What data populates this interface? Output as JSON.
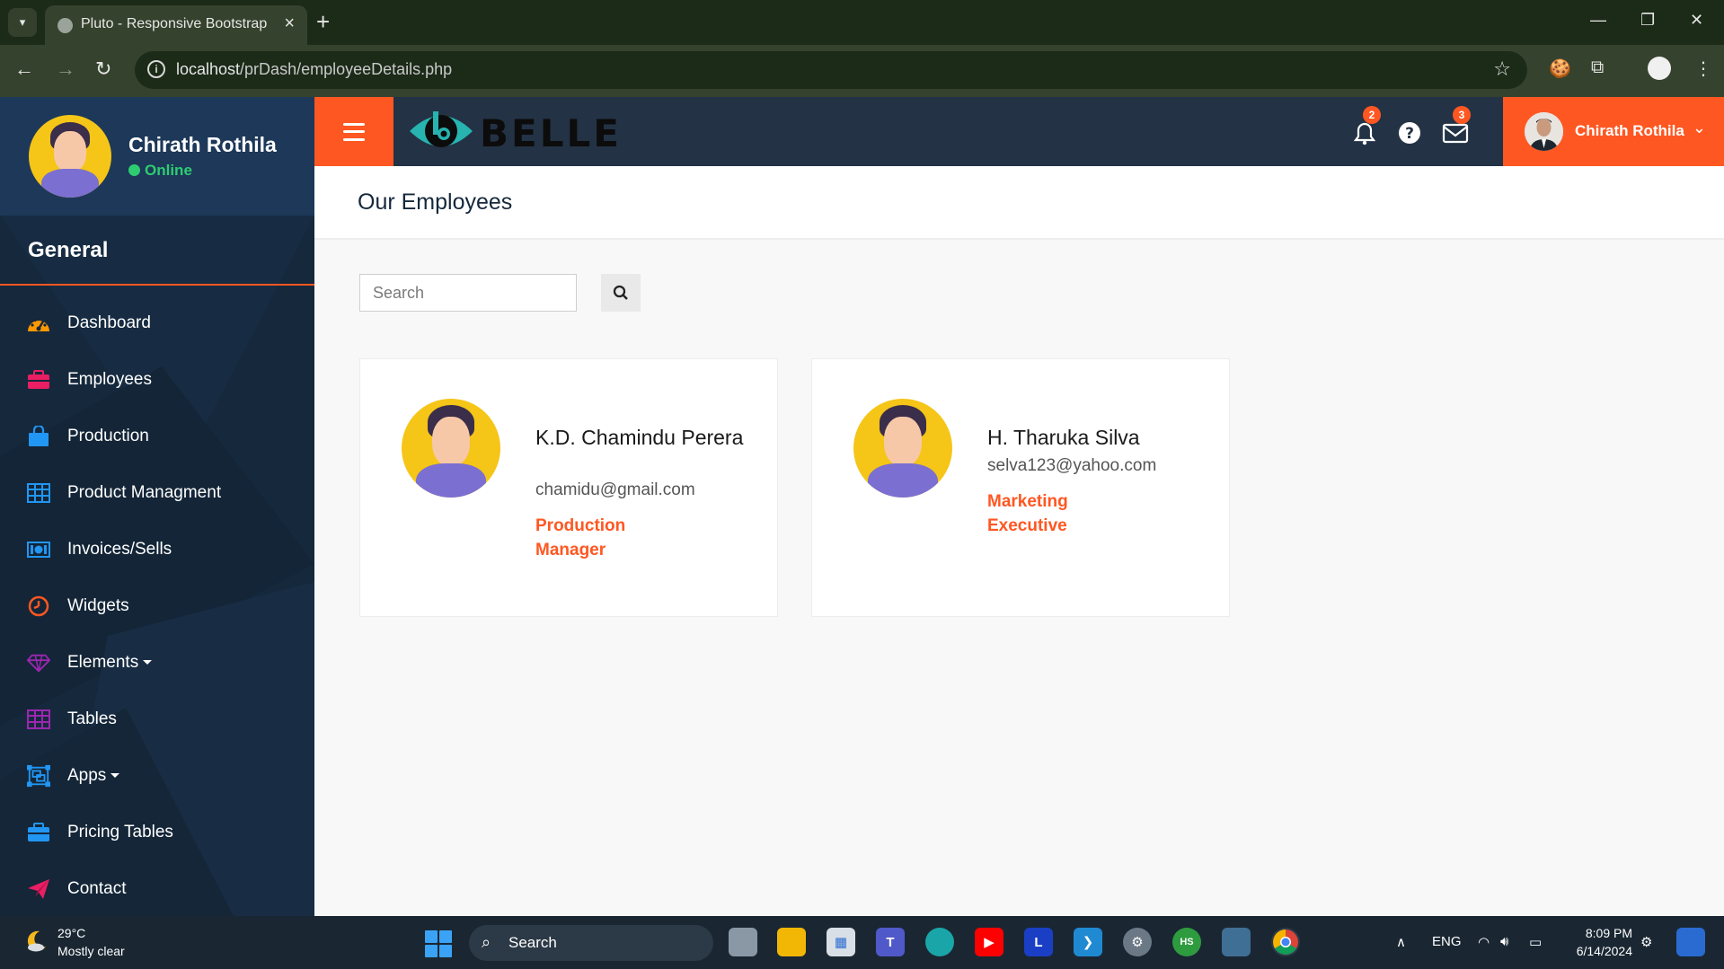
{
  "browser": {
    "tab_title": "Pluto - Responsive Bootstrap Ad",
    "url_host": "localhost",
    "url_path": "/prDash/employeeDetails.php"
  },
  "sidebar": {
    "user_name": "Chirath Rothila",
    "user_status": "Online",
    "section_title": "General",
    "items": [
      {
        "label": "Dashboard",
        "icon": "dashboard-icon",
        "color": "#ff9800",
        "has_caret": false
      },
      {
        "label": "Employees",
        "icon": "briefcase-icon",
        "color": "#e91e63",
        "has_caret": false
      },
      {
        "label": "Production",
        "icon": "shopping-bag-icon",
        "color": "#2196f3",
        "has_caret": false
      },
      {
        "label": "Product Managment",
        "icon": "table-icon",
        "color": "#2196f3",
        "has_caret": false
      },
      {
        "label": "Invoices/Sells",
        "icon": "money-icon",
        "color": "#2196f3",
        "has_caret": false
      },
      {
        "label": "Widgets",
        "icon": "clock-icon",
        "color": "#ff5722",
        "has_caret": false
      },
      {
        "label": "Elements",
        "icon": "diamond-icon",
        "color": "#9c27b0",
        "has_caret": true
      },
      {
        "label": "Tables",
        "icon": "table-grid-icon",
        "color": "#9c27b0",
        "has_caret": false
      },
      {
        "label": "Apps",
        "icon": "object-group-icon",
        "color": "#2196f3",
        "has_caret": true
      },
      {
        "label": "Pricing Tables",
        "icon": "briefcase-icon",
        "color": "#2196f3",
        "has_caret": false
      },
      {
        "label": "Contact",
        "icon": "paper-plane-icon",
        "color": "#e91e63",
        "has_caret": false
      }
    ]
  },
  "topbar": {
    "brand": "BELLE",
    "notifications_count": "2",
    "messages_count": "3",
    "user_name": "Chirath Rothila"
  },
  "page": {
    "title": "Our Employees",
    "search_placeholder": "Search"
  },
  "employees": [
    {
      "name": "K.D. Chamindu Perera",
      "email": "chamidu@gmail.com",
      "role": "Production Manager"
    },
    {
      "name": "H. Tharuka Silva",
      "email": "selva123@yahoo.com",
      "role": "Marketing Executive"
    }
  ],
  "taskbar": {
    "temperature": "29°C",
    "weather": "Mostly clear",
    "search_label": "Search",
    "language": "ENG",
    "time": "8:09 PM",
    "date": "6/14/2024"
  },
  "colors": {
    "accent": "#ff5722",
    "sidebar_bg": "#15283c",
    "topbar_bg": "#233245",
    "online": "#2ecc71"
  }
}
